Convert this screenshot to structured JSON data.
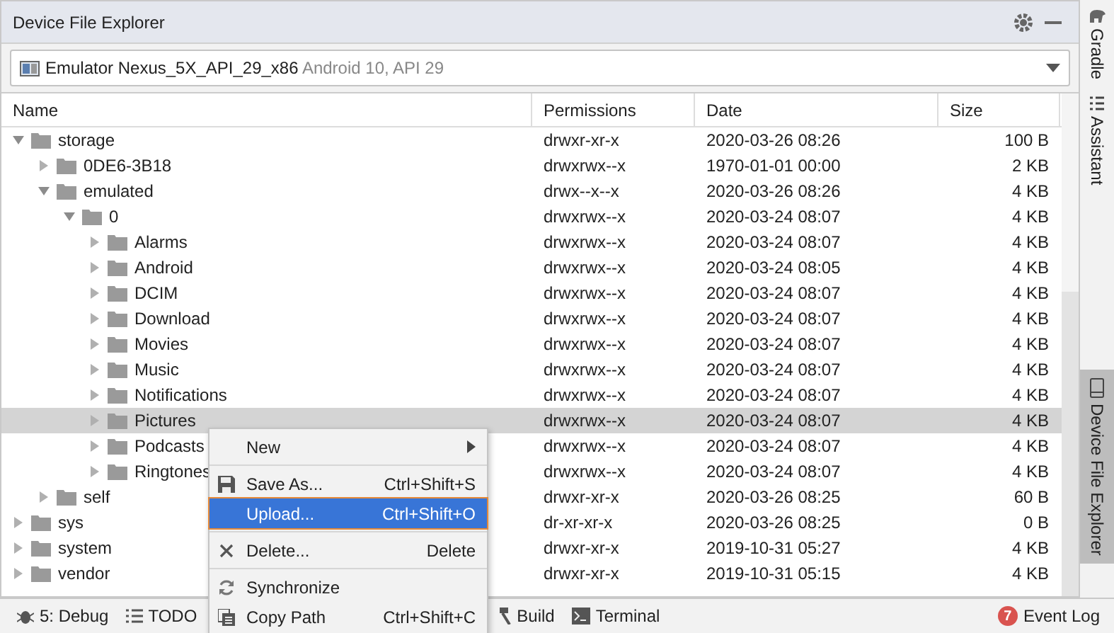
{
  "panel": {
    "title": "Device File Explorer"
  },
  "device": {
    "name": "Emulator Nexus_5X_API_29_x86",
    "detail": "Android 10, API 29"
  },
  "columns": [
    "Name",
    "Permissions",
    "Date",
    "Size"
  ],
  "tree": [
    {
      "name": "storage",
      "permissions": "drwxr-xr-x",
      "date": "2020-03-26 08:26",
      "size": "100 B",
      "expanded": true,
      "selected": false,
      "children": [
        {
          "name": "0DE6-3B18",
          "permissions": "drwxrwx--x",
          "date": "1970-01-01 00:00",
          "size": "2 KB",
          "expanded": false,
          "selected": false
        },
        {
          "name": "emulated",
          "permissions": "drwx--x--x",
          "date": "2020-03-26 08:26",
          "size": "4 KB",
          "expanded": true,
          "selected": false,
          "children": [
            {
              "name": "0",
              "permissions": "drwxrwx--x",
              "date": "2020-03-24 08:07",
              "size": "4 KB",
              "expanded": true,
              "selected": false,
              "children": [
                {
                  "name": "Alarms",
                  "permissions": "drwxrwx--x",
                  "date": "2020-03-24 08:07",
                  "size": "4 KB",
                  "expanded": false,
                  "selected": false
                },
                {
                  "name": "Android",
                  "permissions": "drwxrwx--x",
                  "date": "2020-03-24 08:05",
                  "size": "4 KB",
                  "expanded": false,
                  "selected": false
                },
                {
                  "name": "DCIM",
                  "permissions": "drwxrwx--x",
                  "date": "2020-03-24 08:07",
                  "size": "4 KB",
                  "expanded": false,
                  "selected": false
                },
                {
                  "name": "Download",
                  "permissions": "drwxrwx--x",
                  "date": "2020-03-24 08:07",
                  "size": "4 KB",
                  "expanded": false,
                  "selected": false
                },
                {
                  "name": "Movies",
                  "permissions": "drwxrwx--x",
                  "date": "2020-03-24 08:07",
                  "size": "4 KB",
                  "expanded": false,
                  "selected": false
                },
                {
                  "name": "Music",
                  "permissions": "drwxrwx--x",
                  "date": "2020-03-24 08:07",
                  "size": "4 KB",
                  "expanded": false,
                  "selected": false
                },
                {
                  "name": "Notifications",
                  "permissions": "drwxrwx--x",
                  "date": "2020-03-24 08:07",
                  "size": "4 KB",
                  "expanded": false,
                  "selected": false
                },
                {
                  "name": "Pictures",
                  "permissions": "drwxrwx--x",
                  "date": "2020-03-24 08:07",
                  "size": "4 KB",
                  "expanded": false,
                  "selected": true
                },
                {
                  "name": "Podcasts",
                  "permissions": "drwxrwx--x",
                  "date": "2020-03-24 08:07",
                  "size": "4 KB",
                  "expanded": false,
                  "selected": false
                },
                {
                  "name": "Ringtones",
                  "permissions": "drwxrwx--x",
                  "date": "2020-03-24 08:07",
                  "size": "4 KB",
                  "expanded": false,
                  "selected": false
                }
              ]
            }
          ]
        },
        {
          "name": "self",
          "permissions": "drwxr-xr-x",
          "date": "2020-03-26 08:25",
          "size": "60 B",
          "expanded": false,
          "selected": false
        }
      ]
    },
    {
      "name": "sys",
      "permissions": "dr-xr-xr-x",
      "date": "2020-03-26 08:25",
      "size": "0 B",
      "expanded": false,
      "selected": false
    },
    {
      "name": "system",
      "permissions": "drwxr-xr-x",
      "date": "2019-10-31 05:27",
      "size": "4 KB",
      "expanded": false,
      "selected": false
    },
    {
      "name": "vendor",
      "permissions": "drwxr-xr-x",
      "date": "2019-10-31 05:15",
      "size": "4 KB",
      "expanded": false,
      "selected": false
    }
  ],
  "context_menu": [
    {
      "kind": "new",
      "label": "New",
      "selected": false
    },
    {
      "kind": "separator"
    },
    {
      "kind": "save",
      "label": "Save As...",
      "shortcut": "Ctrl+Shift+S",
      "selected": false
    },
    {
      "kind": "upload",
      "label": "Upload...",
      "shortcut": "Ctrl+Shift+O",
      "selected": true
    },
    {
      "kind": "separator"
    },
    {
      "kind": "delete",
      "label": "Delete...",
      "shortcut": "Delete",
      "selected": false
    },
    {
      "kind": "separator"
    },
    {
      "kind": "sync",
      "label": "Synchronize",
      "selected": false
    },
    {
      "kind": "copy",
      "label": "Copy Path",
      "shortcut": "Ctrl+Shift+C",
      "selected": false
    }
  ],
  "bottom_tools": [
    {
      "kind": "debug",
      "label": "5: Debug"
    },
    {
      "kind": "todo",
      "label": "TODO"
    },
    {
      "kind": "build",
      "label": "Build"
    },
    {
      "kind": "terminal",
      "label": "Terminal"
    }
  ],
  "event_log": {
    "label": "Event Log",
    "count": "7"
  },
  "side_tabs": [
    {
      "kind": "gradle",
      "label": "Gradle",
      "selected": false
    },
    {
      "kind": "assistant",
      "label": "Assistant",
      "selected": false
    },
    {
      "kind": "device",
      "label": "Device File Explorer",
      "selected": true
    }
  ]
}
